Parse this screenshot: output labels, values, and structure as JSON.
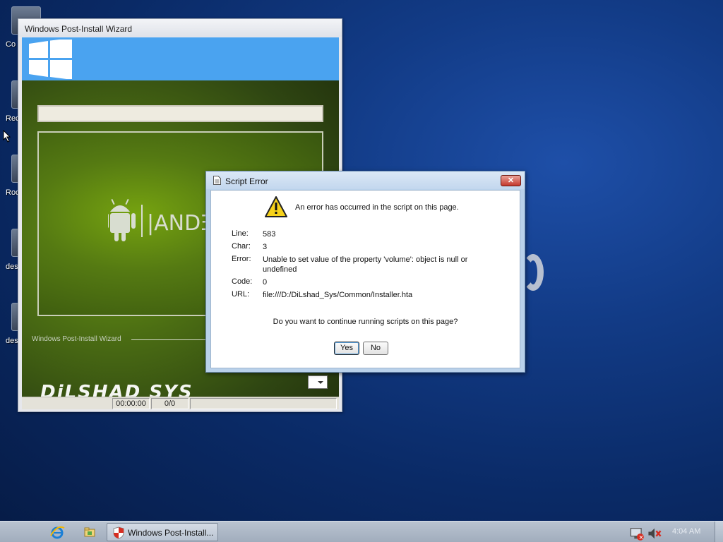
{
  "desktop": {
    "icons": [
      {
        "label": "Co"
      },
      {
        "label": "Rec"
      },
      {
        "label": "Roo"
      },
      {
        "label": "des"
      },
      {
        "label": "des"
      }
    ]
  },
  "wizard": {
    "title": "Windows Post-Install Wizard",
    "footer_label": "Windows Post-Install Wizard",
    "brand_text": "DiLSHAD SYS",
    "logo_text": "|ANDƎ",
    "status": {
      "time": "00:00:00",
      "progress": "0/0"
    }
  },
  "dialog": {
    "title": "Script Error",
    "close_label": "✕",
    "message": "An error has occurred in the script on this page.",
    "details": [
      {
        "label": "Line:",
        "value": "583"
      },
      {
        "label": "Char:",
        "value": "3"
      },
      {
        "label": "Error:",
        "value": "Unable to set value of the property 'volume': object is null or undefined"
      },
      {
        "label": "Code:",
        "value": "0"
      },
      {
        "label": "URL:",
        "value": "file:///D:/DiLshad_Sys/Common/Installer.hta"
      }
    ],
    "question": "Do you want to continue running scripts on this page?",
    "yes_label": "Yes",
    "no_label": "No"
  },
  "taskbar": {
    "task_label": "Windows Post-Install...",
    "clock": "4:04 AM"
  },
  "colors": {
    "desktop_blue": "#0a2a66",
    "wizard_green": "#4b6d13",
    "banner_blue": "#4aa3f0",
    "close_red": "#c4382c"
  }
}
